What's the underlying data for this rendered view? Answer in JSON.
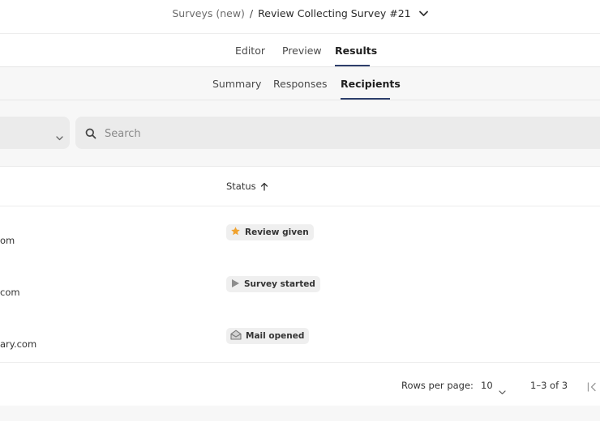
{
  "breadcrumb": {
    "parent": "Surveys (new)",
    "separator": "/",
    "current": "Review Collecting Survey #21"
  },
  "main_tabs": [
    {
      "label": "Editor",
      "active": false
    },
    {
      "label": "Preview",
      "active": false
    },
    {
      "label": "Results",
      "active": true
    }
  ],
  "sub_tabs": [
    {
      "label": "Summary",
      "active": false
    },
    {
      "label": "Responses",
      "active": false
    },
    {
      "label": "Recipients",
      "active": true
    }
  ],
  "search": {
    "placeholder": "Search",
    "value": ""
  },
  "table": {
    "status_header": "Status",
    "sort_direction": "ascending",
    "rows": [
      {
        "email_partial": "om",
        "status": "Review given",
        "status_icon": "star-icon"
      },
      {
        "email_partial": "com",
        "status": "Survey started",
        "status_icon": "play-icon"
      },
      {
        "email_partial": "ary.com",
        "status": "Mail opened",
        "status_icon": "envelope-open-icon"
      }
    ]
  },
  "pagination": {
    "rows_per_page_label": "Rows per page:",
    "rows_per_page_value": "10",
    "range_text": "1–3 of 3"
  },
  "colors": {
    "accent_underline": "#2d3e6b",
    "star": "#f0a22e",
    "badge_bg": "#efefef"
  }
}
